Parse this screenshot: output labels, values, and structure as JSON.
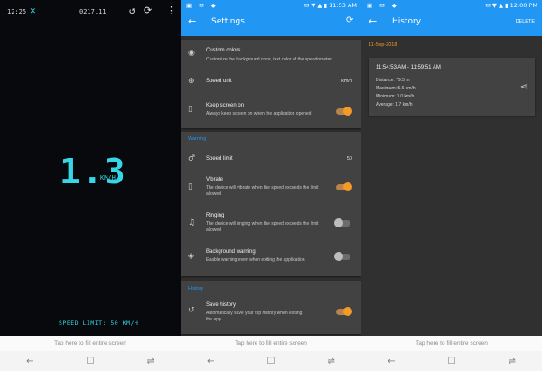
{
  "fill_screen_text": "Tap here to fill entire screen",
  "nav": {
    "back": "←",
    "home": "☐",
    "recent": "⇌"
  },
  "speedometer": {
    "status_time": "12:25",
    "fullscreen_icon": "✕",
    "odometer": "0217.11",
    "reset_icon": "↺",
    "rotate_icon": "⟳",
    "more_icon": "⋮",
    "speed_value": "1.3",
    "speed_unit": "KM/H",
    "speed_limit_text": "SPEED LIMIT: 50 KM/H",
    "accent_color": "#37d6e6"
  },
  "android_status": {
    "icons": "▣ ✉ ◆",
    "right": "✉ ▼ ▲ ▮ 11:53 AM"
  },
  "android_status_history": {
    "icons": "▣ ✉ ◆",
    "right": "✉ ▼ ▲ ▮ 12:00 PM"
  },
  "settings": {
    "title": "Settings",
    "custom_colors": {
      "title": "Custom colors",
      "desc": "Customize the background color, text color of the speedometer"
    },
    "speed_unit": {
      "title": "Speed unit",
      "value": "km/h"
    },
    "keep_screen_on": {
      "title": "Keep screen on",
      "desc": "Always keep screen on when the application opened",
      "on": true
    },
    "warning_section": "Warning",
    "speed_limit": {
      "title": "Speed limit",
      "value": "50"
    },
    "vibrate": {
      "title": "Vibrate",
      "desc": "The device will vibrate when the speed exceeds the limit allowed",
      "on": true
    },
    "ringing": {
      "title": "Ringing",
      "desc": "The device will ringing when the speed exceeds the limit allowed",
      "on": false
    },
    "background_warning": {
      "title": "Background warning",
      "desc": "Enable warning even when exiting the application",
      "on": false
    },
    "history_section": "History",
    "save_history": {
      "title": "Save history",
      "desc": "Automatically save your trip history when exiting the app",
      "on": true
    }
  },
  "history": {
    "title": "History",
    "delete_label": "DELETE",
    "date": "11-Sep-2018",
    "range": "11:54:53 AM - 11:59:51 AM",
    "distance": "Distance:  79.5 m",
    "maximum": "Maximum:  5.6 km/h",
    "minimum": "Minimum:  0.0 km/h",
    "average": "Average:  1.7 km/h"
  },
  "colors": {
    "appbar": "#2196f3",
    "toggle_on": "#f39b26",
    "history_date": "#f39b26"
  }
}
